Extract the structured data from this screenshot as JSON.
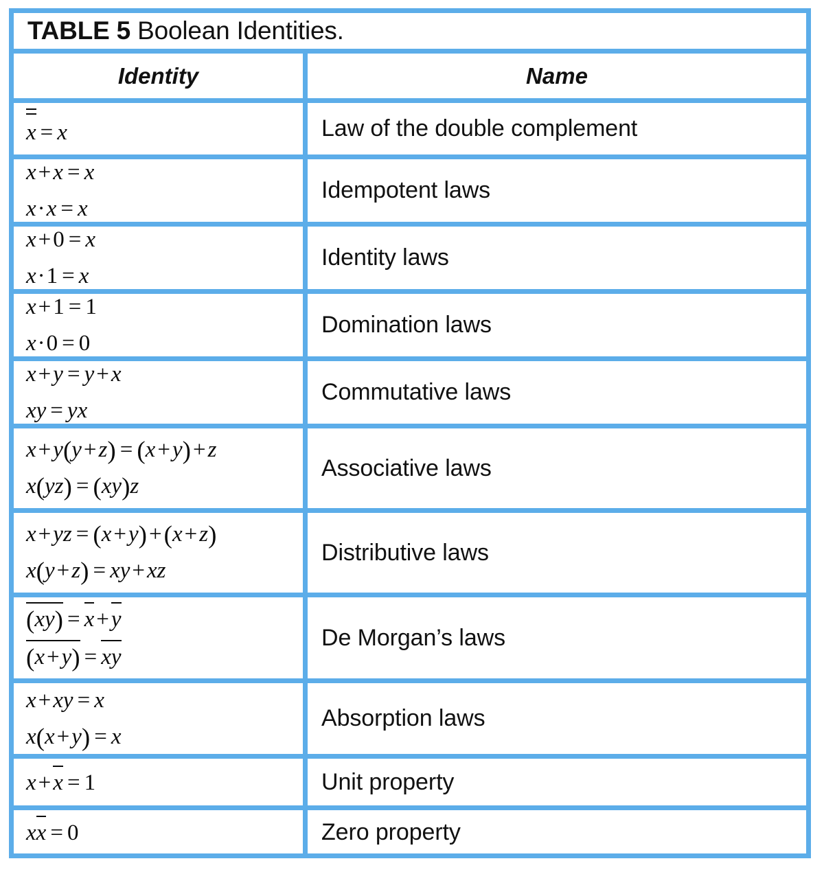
{
  "table": {
    "title_number": "TABLE 5",
    "title_text": " Boolean Identities.",
    "columns": {
      "identity": "Identity",
      "name": "Name"
    },
    "border_color": "#5cade9",
    "text_color": "#111111",
    "background_color": "#ffffff",
    "rows": [
      {
        "identity_plain": "x̅̅ = x",
        "lines": [
          "=̅x = x"
        ],
        "name": "Law of the double complement"
      },
      {
        "identity_plain": "x + x = x ; x · x = x",
        "lines": [
          "x + x = x",
          "x · x = x"
        ],
        "name": "Idempotent laws"
      },
      {
        "identity_plain": "x + 0 = x ; x · 1 = x",
        "lines": [
          "x + 0 = x",
          "x · 1 = x"
        ],
        "name": "Identity laws"
      },
      {
        "identity_plain": "x + 1 = 1 ; x · 0 = 0",
        "lines": [
          "x + 1 = 1",
          "x · 0 = 0"
        ],
        "name": "Domination laws"
      },
      {
        "identity_plain": "x + y = y + x ; xy = yx",
        "lines": [
          "x + y = y + x",
          "xy = yx"
        ],
        "name": "Commutative laws"
      },
      {
        "identity_plain": "x + y(y + z) = (x + y) + z ; x(yz) = (xy)z",
        "lines": [
          "x + y(y + z) = (x + y) + z",
          "x(yz) = (xy)z"
        ],
        "name": "Associative laws"
      },
      {
        "identity_plain": "x + yz = (x + y) + (x + z) ; x(y + z) = xy + xz",
        "lines": [
          "x + yz = (x + y) + (x + z)",
          "x(y + z) = xy + xz"
        ],
        "name": "Distributive laws"
      },
      {
        "identity_plain": "(xy)̅ = x̅ + y̅ ; (x + y)̅ = x̅ y̅",
        "lines": [
          "(xy)̅ = x̅ + y̅",
          "(x + y)̅ = x̅y̅"
        ],
        "name": "De Morgan’s laws"
      },
      {
        "identity_plain": "x + xy = x ; x(x + y) = x",
        "lines": [
          "x + xy = x",
          "x(x + y) = x"
        ],
        "name": "Absorption laws"
      },
      {
        "identity_plain": "x + x̅ = 1",
        "lines": [
          "x + x̅ = 1"
        ],
        "name": "Unit property"
      },
      {
        "identity_plain": "x x̅ = 0",
        "lines": [
          "x x̅ = 0"
        ],
        "name": "Zero property"
      }
    ]
  },
  "glyphs": {
    "x": "x",
    "y": "y",
    "z": "z",
    "zero": "0",
    "one": "1",
    "plus": "+",
    "equals": "=",
    "dot": "·",
    "lparen": "(",
    "rparen": ")"
  }
}
